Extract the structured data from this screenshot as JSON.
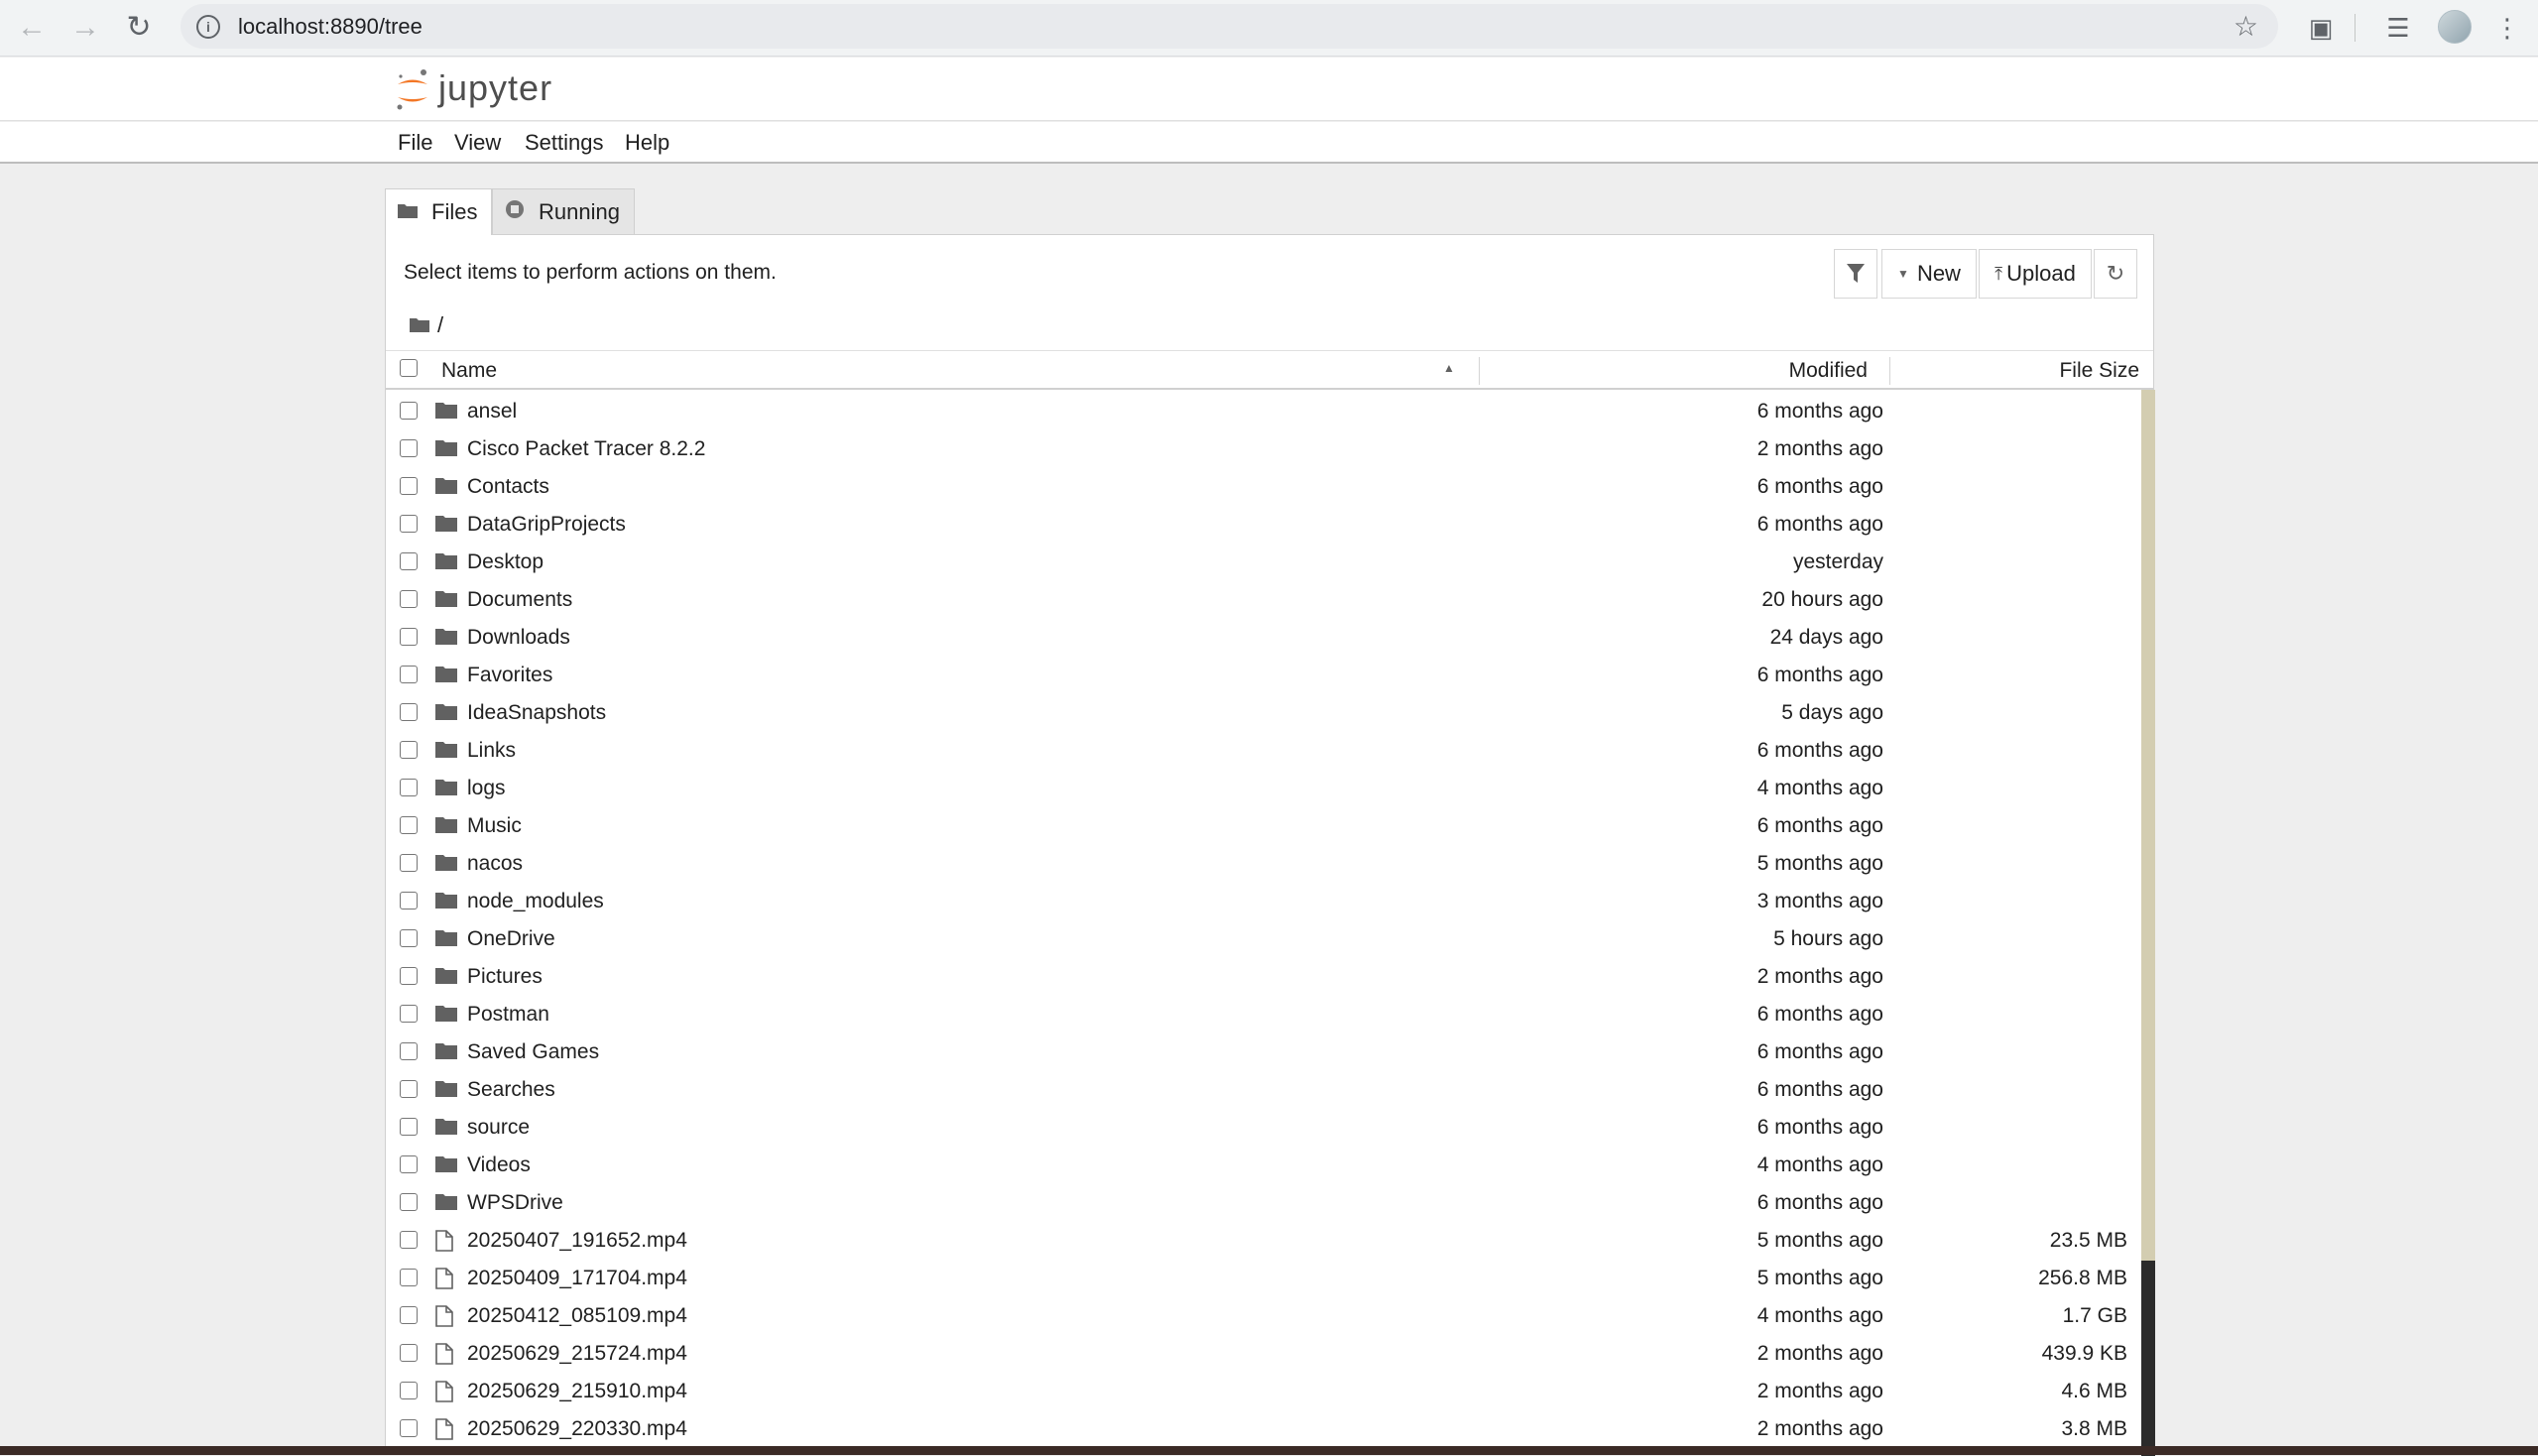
{
  "browser": {
    "url": "localhost:8890/tree",
    "info_icon": "info-icon",
    "back_icon": "arrow-left-icon",
    "forward_icon": "arrow-right-icon",
    "reload_icon": "reload-icon"
  },
  "header": {
    "wordmark": "jupyter"
  },
  "menu": {
    "file": "File",
    "view": "View",
    "settings": "Settings",
    "help": "Help"
  },
  "tabs": {
    "files": "Files",
    "running": "Running"
  },
  "toolbar": {
    "hint": "Select items to perform actions on them.",
    "new_label": "New",
    "upload_label": "Upload"
  },
  "breadcrumb": {
    "path": "/"
  },
  "columns": {
    "name": "Name",
    "modified": "Modified",
    "size": "File Size"
  },
  "files": [
    {
      "name": "ansel",
      "type": "folder",
      "modified": "6 months ago",
      "size": ""
    },
    {
      "name": "Cisco Packet Tracer 8.2.2",
      "type": "folder",
      "modified": "2 months ago",
      "size": ""
    },
    {
      "name": "Contacts",
      "type": "folder",
      "modified": "6 months ago",
      "size": ""
    },
    {
      "name": "DataGripProjects",
      "type": "folder",
      "modified": "6 months ago",
      "size": ""
    },
    {
      "name": "Desktop",
      "type": "folder",
      "modified": "yesterday",
      "size": ""
    },
    {
      "name": "Documents",
      "type": "folder",
      "modified": "20 hours ago",
      "size": ""
    },
    {
      "name": "Downloads",
      "type": "folder",
      "modified": "24 days ago",
      "size": ""
    },
    {
      "name": "Favorites",
      "type": "folder",
      "modified": "6 months ago",
      "size": ""
    },
    {
      "name": "IdeaSnapshots",
      "type": "folder",
      "modified": "5 days ago",
      "size": ""
    },
    {
      "name": "Links",
      "type": "folder",
      "modified": "6 months ago",
      "size": ""
    },
    {
      "name": "logs",
      "type": "folder",
      "modified": "4 months ago",
      "size": ""
    },
    {
      "name": "Music",
      "type": "folder",
      "modified": "6 months ago",
      "size": ""
    },
    {
      "name": "nacos",
      "type": "folder",
      "modified": "5 months ago",
      "size": ""
    },
    {
      "name": "node_modules",
      "type": "folder",
      "modified": "3 months ago",
      "size": ""
    },
    {
      "name": "OneDrive",
      "type": "folder",
      "modified": "5 hours ago",
      "size": ""
    },
    {
      "name": "Pictures",
      "type": "folder",
      "modified": "2 months ago",
      "size": ""
    },
    {
      "name": "Postman",
      "type": "folder",
      "modified": "6 months ago",
      "size": ""
    },
    {
      "name": "Saved Games",
      "type": "folder",
      "modified": "6 months ago",
      "size": ""
    },
    {
      "name": "Searches",
      "type": "folder",
      "modified": "6 months ago",
      "size": ""
    },
    {
      "name": "source",
      "type": "folder",
      "modified": "6 months ago",
      "size": ""
    },
    {
      "name": "Videos",
      "type": "folder",
      "modified": "4 months ago",
      "size": ""
    },
    {
      "name": "WPSDrive",
      "type": "folder",
      "modified": "6 months ago",
      "size": ""
    },
    {
      "name": "20250407_191652.mp4",
      "type": "file",
      "modified": "5 months ago",
      "size": "23.5 MB"
    },
    {
      "name": "20250409_171704.mp4",
      "type": "file",
      "modified": "5 months ago",
      "size": "256.8 MB"
    },
    {
      "name": "20250412_085109.mp4",
      "type": "file",
      "modified": "4 months ago",
      "size": "1.7 GB"
    },
    {
      "name": "20250629_215724.mp4",
      "type": "file",
      "modified": "2 months ago",
      "size": "439.9 KB"
    },
    {
      "name": "20250629_215910.mp4",
      "type": "file",
      "modified": "2 months ago",
      "size": "4.6 MB"
    },
    {
      "name": "20250629_220330.mp4",
      "type": "file",
      "modified": "2 months ago",
      "size": "3.8 MB"
    }
  ]
}
